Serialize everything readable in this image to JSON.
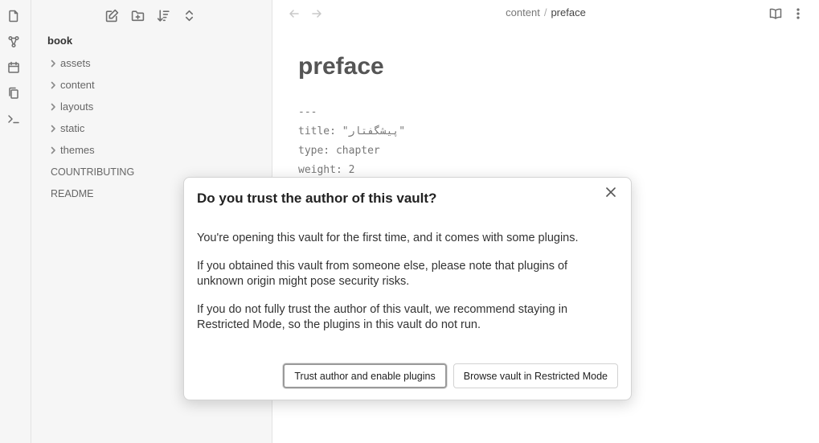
{
  "ribbon": {
    "icons": [
      "files-icon",
      "graph-icon",
      "calendar-icon",
      "copy-icon",
      "terminal-icon"
    ]
  },
  "sidebar": {
    "nav_icons": [
      "new-note-icon",
      "new-folder-icon",
      "sort-icon",
      "collapse-icon"
    ],
    "vault_name": "book",
    "folders": [
      {
        "label": "assets"
      },
      {
        "label": "content"
      },
      {
        "label": "layouts"
      },
      {
        "label": "static"
      },
      {
        "label": "themes"
      }
    ],
    "files": [
      {
        "label": "COUNTRIBUTING"
      },
      {
        "label": "README"
      }
    ]
  },
  "main": {
    "breadcrumb": {
      "parent": "content",
      "separator": "/",
      "current": "preface"
    },
    "title": "preface",
    "frontmatter": [
      "---",
      "title: \"پیشگفتار\"",
      "type: chapter",
      "weight: 2"
    ]
  },
  "modal": {
    "title": "Do you trust the author of this vault?",
    "paragraphs": [
      "You're opening this vault for the first time, and it comes with some plugins.",
      "If you obtained this vault from someone else, please note that plugins of unknown origin might pose security risks.",
      "If you do not fully trust the author of this vault, we recommend staying in Restricted Mode, so the plugins in this vault do not run."
    ],
    "trust_button": "Trust author and enable plugins",
    "restricted_button": "Browse vault in Restricted Mode"
  }
}
